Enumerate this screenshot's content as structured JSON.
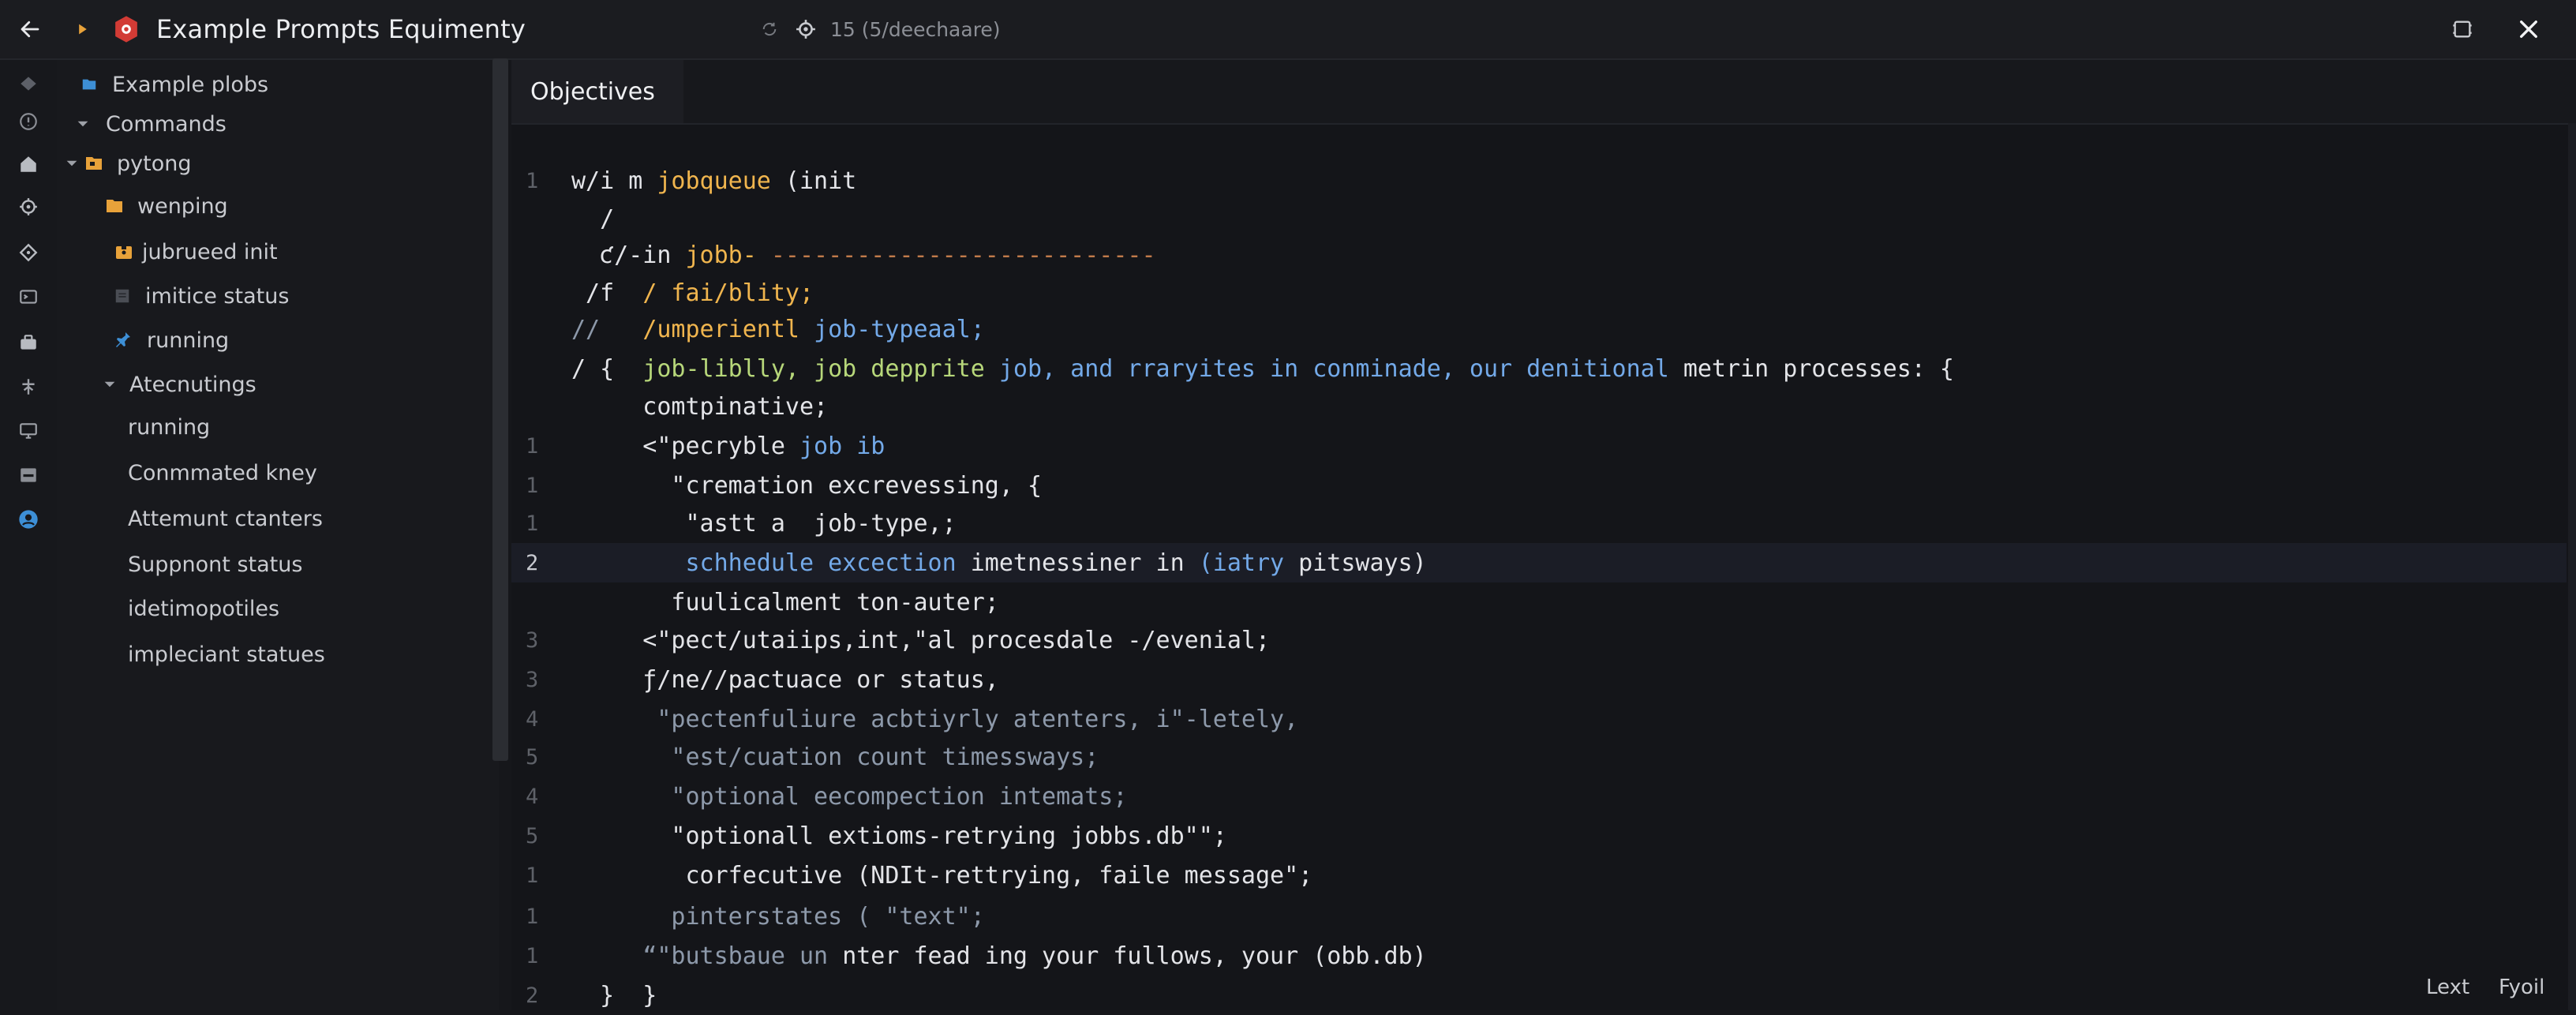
{
  "titlebar": {
    "title": "Example Prompts Equimenty",
    "status": "15 (5/deechaare)",
    "icons": [
      "back-arrow-icon",
      "play-icon",
      "app-logo-icon",
      "refresh-icon",
      "settings-icon",
      "panel-toggle-icon",
      "close-icon"
    ]
  },
  "activity_bar": {
    "icons": [
      "explorer-icon",
      "info-icon",
      "home-icon",
      "settings-icon",
      "tag-icon",
      "terminal-icon",
      "briefcase-icon",
      "plugin-icon",
      "monitor-icon",
      "store-icon",
      "account-icon"
    ]
  },
  "sidebar": {
    "items": [
      {
        "label": "Example plobs",
        "icon": "folder-icon"
      },
      {
        "label": "Commands",
        "icon": "chevron-down-icon"
      },
      {
        "label": "pytong",
        "icon": "folder-open-icon"
      },
      {
        "label": "wenping",
        "icon": "folder-icon"
      },
      {
        "label": "jubrueed init",
        "icon": "package-icon"
      },
      {
        "label": "imitice status",
        "icon": "file-icon"
      },
      {
        "label": "running",
        "icon": "pin-icon"
      },
      {
        "label": "Atecnutings",
        "icon": "chevron-down-icon"
      },
      {
        "label": "running",
        "icon": ""
      },
      {
        "label": "Conmmated kney",
        "icon": ""
      },
      {
        "label": "Attemunt ctanters",
        "icon": ""
      },
      {
        "label": "Suppnont status",
        "icon": ""
      },
      {
        "label": "idetimopotiles",
        "icon": ""
      },
      {
        "label": "impleciant statues",
        "icon": ""
      }
    ]
  },
  "editor": {
    "tab": "Objectives",
    "lines": [
      {
        "num": "1",
        "segs": [
          [
            "w/i m ",
            "default"
          ],
          [
            "jobqueue",
            "orange"
          ],
          [
            " (init",
            "default"
          ]
        ]
      },
      {
        "num": "",
        "segs": [
          [
            "  /",
            "default"
          ]
        ]
      },
      {
        "num": "",
        "segs": [
          [
            "  ",
            ""
          ],
          [
            "ƈ/-in ",
            "default"
          ],
          [
            "jobb- ",
            "orange"
          ],
          [
            "---------------------------",
            "dash"
          ]
        ]
      },
      {
        "num": "",
        "segs": [
          [
            " /f  ",
            "default"
          ],
          [
            "/ fai/blity;",
            "orange"
          ]
        ]
      },
      {
        "num": "",
        "segs": [
          [
            "//   ",
            "muted"
          ],
          [
            "/umperientl ",
            "orange"
          ],
          [
            "job-typeaal;",
            "blue"
          ]
        ]
      },
      {
        "num": "",
        "segs": [
          [
            "/ {  ",
            "default"
          ],
          [
            "job-liblly, job depprite ",
            "green"
          ],
          [
            "job, and rraryites in conminade, our denitional ",
            "blue"
          ],
          [
            "metrin processes: {",
            "default"
          ]
        ]
      },
      {
        "num": "",
        "segs": [
          [
            "     comtpinative;",
            "default"
          ]
        ]
      },
      {
        "num": "1",
        "segs": [
          [
            "     <\"pecryble ",
            "default"
          ],
          [
            "job ib",
            "blue"
          ]
        ]
      },
      {
        "num": "1",
        "segs": [
          [
            "       \"cremation excrevessing, {",
            "default"
          ]
        ]
      },
      {
        "num": "1",
        "segs": [
          [
            "        \"astt a  job-type,;",
            "default"
          ]
        ]
      },
      {
        "num": "2",
        "active": true,
        "segs": [
          [
            "        ",
            ""
          ],
          [
            "schhedule excection ",
            "blue"
          ],
          [
            "imetnessiner in ",
            "default"
          ],
          [
            "(iatry ",
            "blue"
          ],
          [
            "pitsways)",
            "default"
          ]
        ]
      },
      {
        "num": "",
        "segs": [
          [
            "       fuulicalment ton-auter;",
            "default"
          ]
        ]
      },
      {
        "num": "3",
        "segs": [
          [
            "     <\"pect/utaiips,int,\"al procesdale -/evenial;",
            "default"
          ]
        ]
      },
      {
        "num": "3",
        "segs": [
          [
            "     ƒ/ne//pactuace or status,",
            "default"
          ]
        ]
      },
      {
        "num": "4",
        "segs": [
          [
            "      \"pectenfuliure acbtiyrly atenters, i\"-letely,",
            "muted"
          ]
        ]
      },
      {
        "num": "5",
        "segs": [
          [
            "       \"est/cuation count timessways;",
            "muted"
          ]
        ]
      },
      {
        "num": "4",
        "segs": [
          [
            "       \"optional eecompection intemats;",
            "muted"
          ]
        ]
      },
      {
        "num": "5",
        "segs": [
          [
            "       \"optionall extioms-retrying jobbs.db\"\";",
            "default"
          ]
        ]
      },
      {
        "num": "1",
        "segs": [
          [
            "        corfecutive (NDIt-rettrying, faile message\";",
            "default"
          ]
        ]
      },
      {
        "num": "1",
        "segs": [
          [
            "       pinterstates ( \"text\";",
            "muted"
          ]
        ]
      },
      {
        "num": "1",
        "segs": [
          [
            "     ",
            ""
          ],
          [
            "“\"butsbaue un ",
            "muted"
          ],
          [
            "nter fead ing your fullows, your (obb.db)",
            "default"
          ]
        ]
      },
      {
        "num": "2",
        "segs": [
          [
            "  }  }",
            "default"
          ]
        ]
      }
    ]
  },
  "statusbar": {
    "left": "Lext",
    "right": "Fyoil"
  },
  "colors": {
    "background": "#16171b",
    "keyword_orange": "#f0b54e",
    "keyword_blue": "#73a9e8",
    "string_green": "#b7d77a",
    "logo_red": "#d23b35",
    "folder_orange": "#e8a23a",
    "accent_blue": "#3d8fd6"
  }
}
